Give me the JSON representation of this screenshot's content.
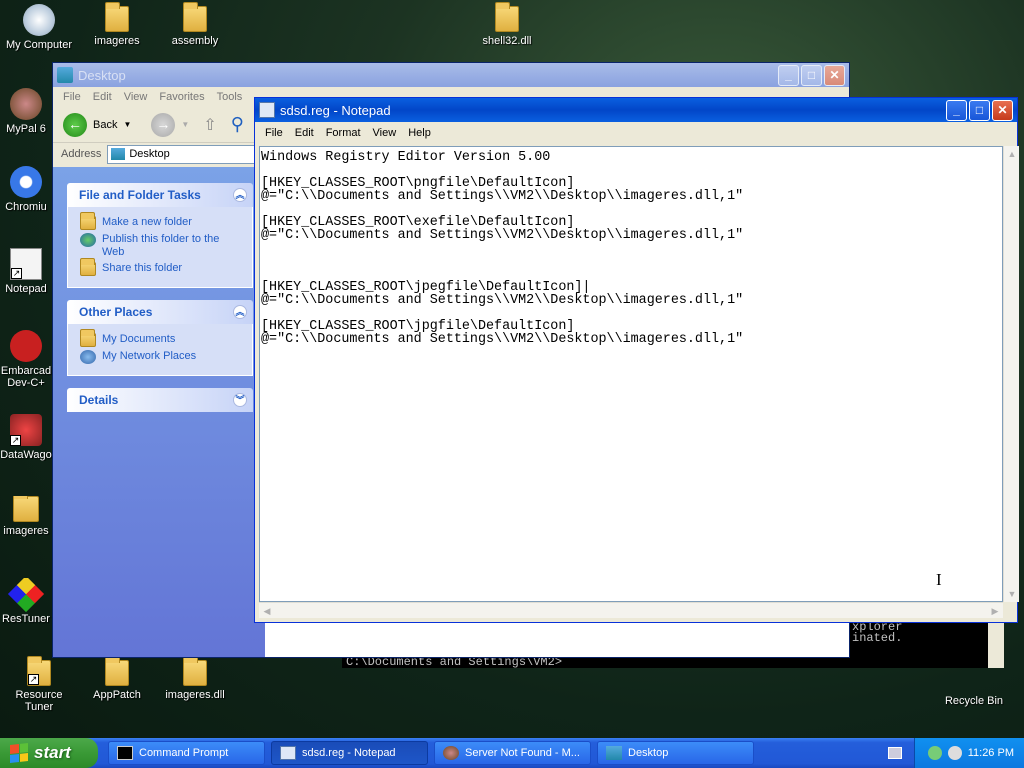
{
  "desktop": {
    "icons": {
      "my_computer": "My Computer",
      "imageres_top": "imageres",
      "assembly": "assembly",
      "shell32": "shell32.dll",
      "mypal": "MyPal 6",
      "chromium": "Chromiu",
      "notepad": "Notepad",
      "embarcadero_1": "Embarcad",
      "embarcadero_2": "Dev-C+",
      "datawagon": "DataWago",
      "imageres_side": "imageres",
      "restuner": "ResTuner",
      "resource_tuner_1": "Resource",
      "resource_tuner_2": "Tuner",
      "apppatch": "AppPatch",
      "imageres_dll": "imageres.dll",
      "recycle_bin": "Recycle Bin"
    }
  },
  "explorer": {
    "title": "Desktop",
    "menu": [
      "File",
      "Edit",
      "View",
      "Favorites",
      "Tools"
    ],
    "back_label": "Back",
    "address_label": "Address",
    "address_value": "Desktop",
    "panels": {
      "file_tasks": {
        "title": "File and Folder Tasks",
        "items": [
          "Make a new folder",
          "Publish this folder to the Web",
          "Share this folder"
        ]
      },
      "other_places": {
        "title": "Other Places",
        "items": [
          "My Documents",
          "My Network Places"
        ]
      },
      "details": {
        "title": "Details"
      }
    }
  },
  "notepad": {
    "title": "sdsd.reg - Notepad",
    "menu": [
      "File",
      "Edit",
      "Format",
      "View",
      "Help"
    ],
    "content": "Windows Registry Editor Version 5.00\n\n[HKEY_CLASSES_ROOT\\pngfile\\DefaultIcon]\n@=\"C:\\\\Documents and Settings\\\\VM2\\\\Desktop\\\\imageres.dll,1\"\n\n[HKEY_CLASSES_ROOT\\exefile\\DefaultIcon]\n@=\"C:\\\\Documents and Settings\\\\VM2\\\\Desktop\\\\imageres.dll,1\"\n\n\n\n[HKEY_CLASSES_ROOT\\jpegfile\\DefaultIcon]|\n@=\"C:\\\\Documents and Settings\\\\VM2\\\\Desktop\\\\imageres.dll,1\"\n\n[HKEY_CLASSES_ROOT\\jpgfile\\DefaultIcon]\n@=\"C:\\\\Documents and Settings\\\\VM2\\\\Desktop\\\\imageres.dll,1\""
  },
  "cmd": {
    "side_text": "xplorer\ninated.",
    "prompt": "C:\\Documents and Settings\\VM2>"
  },
  "taskbar": {
    "start_label": "start",
    "buttons": [
      {
        "label": "Command Prompt"
      },
      {
        "label": "sdsd.reg - Notepad"
      },
      {
        "label": "Server Not Found - M..."
      },
      {
        "label": "Desktop"
      }
    ],
    "clock": "11:26 PM"
  }
}
